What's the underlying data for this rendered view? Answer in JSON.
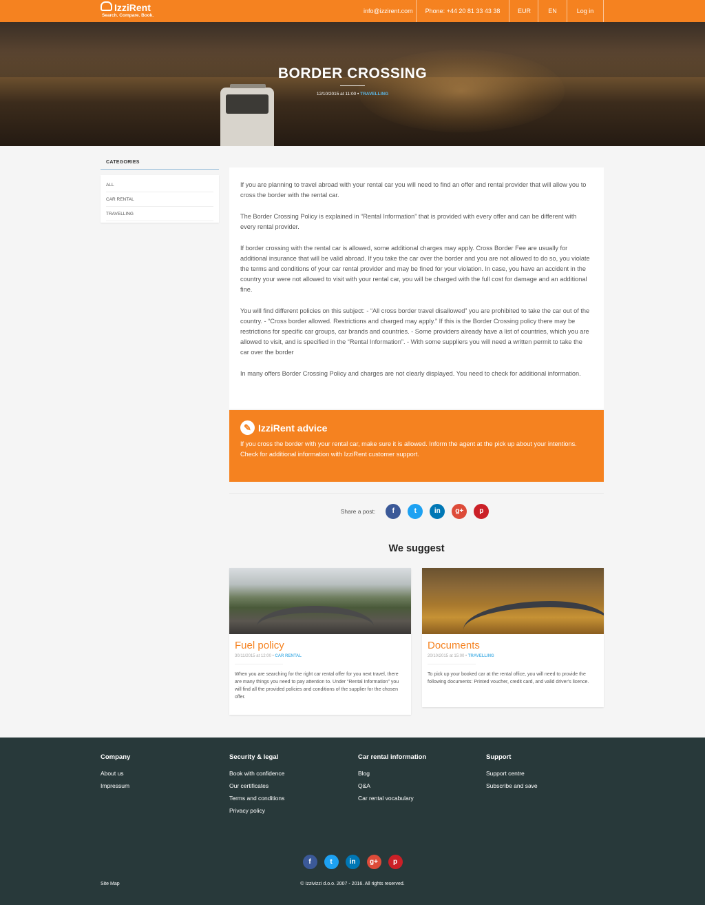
{
  "header": {
    "logo_name": "IzziRent",
    "logo_tagline": "Search. Compare. Book.",
    "email": "info@izzirent.com",
    "phone": "Phone: +44 20 81 33 43 38",
    "currency": "EUR",
    "language": "EN",
    "login": "Log in",
    "accent_color": "#f58220"
  },
  "hero": {
    "title": "BORDER CROSSING",
    "date": "12/10/2015 at 11:00",
    "separator": " • ",
    "category": "TRAVELLING"
  },
  "sidebar": {
    "title": "CATEGORIES",
    "items": [
      {
        "label": "ALL"
      },
      {
        "label": "CAR RENTAL"
      },
      {
        "label": "TRAVELLING"
      }
    ]
  },
  "article": {
    "paragraphs": [
      "If you are planning to travel abroad with your rental car you will need to find an offer and rental provider that will allow you to cross the border with the rental car.",
      "The Border Crossing Policy is explained in “Rental Information” that is provided with every offer and can be different with every rental provider.",
      "If border crossing with the rental car is allowed, some additional charges may apply. Cross Border Fee are usually for additional insurance that will be valid abroad. If you take the car over the border and you are not allowed to do so, you violate the terms and conditions of your car rental provider and may be fined for your violation. In case, you have an accident in the country your were not allowed to visit with your rental car, you will be charged with the full cost for damage and an additional fine.",
      "You will find different policies on this subject: - “All cross border travel disallowed” you are prohibited to take the car out of the country. - “Cross border allowed. Restrictions and charged may apply.” If this is the Border Crossing policy there may be restrictions for specific car groups, car brands and countries. - Some providers already have a list of countries, which you are allowed to visit, and is specified in the “Rental Information”. - With some suppliers you will need a written permit to take the car over the border",
      "In many offers Border Crossing Policy and charges are not clearly displayed. You need to check for additional information."
    ]
  },
  "advice": {
    "title": "IzziRent advice",
    "text": "If you cross the border with your rental car, make sure it is allowed. Inform the agent at the pick up about your intentions. Check for additional information with IzziRent customer support."
  },
  "share": {
    "label": "Share a post:",
    "networks": [
      {
        "name": "facebook-icon",
        "glyph": "f"
      },
      {
        "name": "twitter-icon",
        "glyph": "t"
      },
      {
        "name": "linkedin-icon",
        "glyph": "in"
      },
      {
        "name": "google-plus-icon",
        "glyph": "g+"
      },
      {
        "name": "pinterest-icon",
        "glyph": "p"
      }
    ]
  },
  "suggest": {
    "title": "We suggest",
    "cards": [
      {
        "title": "Fuel policy",
        "date": "30/11/2015 at 12:00",
        "separator": " • ",
        "category": "CAR RENTAL",
        "text": "When you are searching for the right car rental offer for you next travel, there are many things you need to pay attention to. Under “Rental Information” you will find all the provided policies and conditions of the supplier for the chosen offer."
      },
      {
        "title": "Documents",
        "date": "20/10/2015 at 15:00",
        "separator": " • ",
        "category": "TRAVELLING",
        "text": "To pick up your booked car at the rental office, you will need to provide the following documents: Printed voucher, credit card, and valid driver's licence."
      }
    ]
  },
  "footer": {
    "columns": [
      {
        "title": "Company",
        "links": [
          "About us",
          "Impressum"
        ]
      },
      {
        "title": "Security & legal",
        "links": [
          "Book with confidence",
          "Our certificates",
          "Terms and conditions",
          "Privacy policy"
        ]
      },
      {
        "title": "Car rental information",
        "links": [
          "Blog",
          "Q&A",
          "Car rental vocabulary"
        ]
      },
      {
        "title": "Support",
        "links": [
          "Support centre",
          "Subscribe and save"
        ]
      }
    ],
    "sitemap": "Site Map",
    "copyright": "© Izzivizzi d.o.o. 2007 - 2016. All rights reserved.",
    "background_color": "#28393a"
  }
}
